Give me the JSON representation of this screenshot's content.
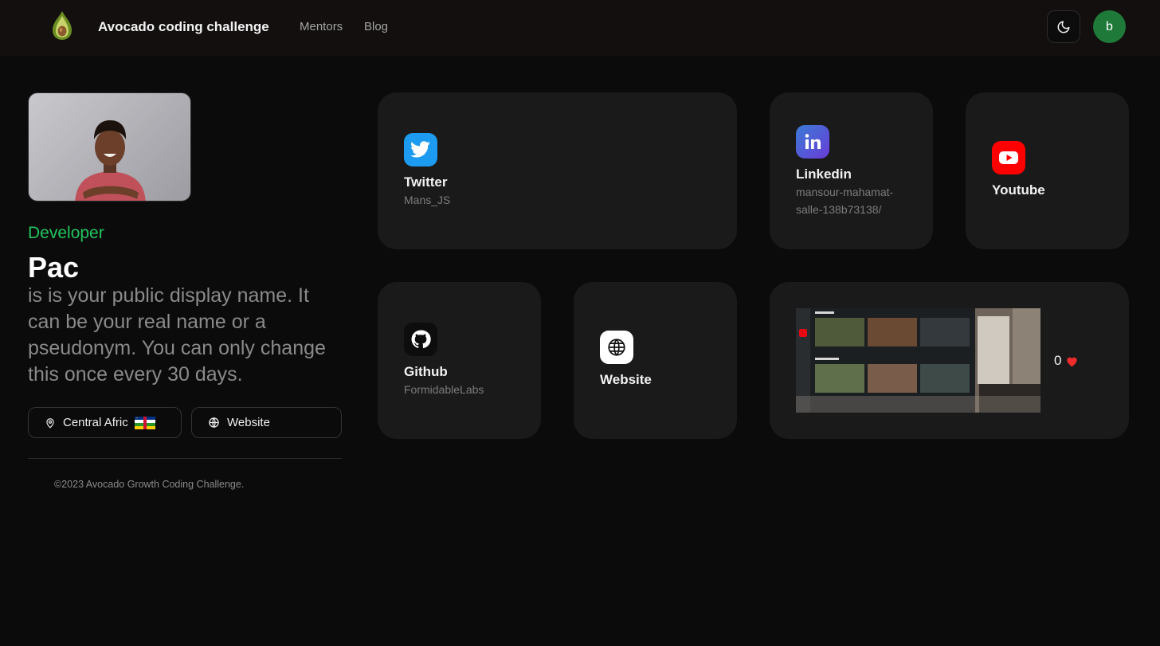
{
  "header": {
    "brand": "Avocado coding challenge",
    "nav": [
      {
        "label": "Mentors"
      },
      {
        "label": "Blog"
      }
    ],
    "theme_icon": "moon-icon",
    "avatar_initial": "b",
    "avatar_color": "#1f7a3a"
  },
  "profile": {
    "role": "Developer",
    "name": "Pac",
    "bio": "is is your public display name. It can be your real name or a pseudonym. You can only change this once every 30 days.",
    "location": "Central Afric",
    "website_label": "Website",
    "role_color": "#22c55e"
  },
  "footer": {
    "text": "©2023 Avocado Growth Coding Challenge."
  },
  "cards": {
    "twitter": {
      "title": "Twitter",
      "handle": "Mans_JS",
      "icon": "twitter-icon",
      "color": "#1d9bf0"
    },
    "linkedin": {
      "title": "Linkedin",
      "handle": "mansour-mahamat-salle-138b73138/",
      "icon": "linkedin-icon",
      "color": "#2d5bd8"
    },
    "youtube": {
      "title": "Youtube",
      "icon": "youtube-icon",
      "color": "#ff0000"
    },
    "github": {
      "title": "Github",
      "handle": "FormidableLabs",
      "icon": "github-icon"
    },
    "website": {
      "title": "Website",
      "icon": "globe-icon"
    },
    "media": {
      "likes": "0",
      "icon": "heart-icon",
      "color": "#ef2b2b"
    }
  }
}
